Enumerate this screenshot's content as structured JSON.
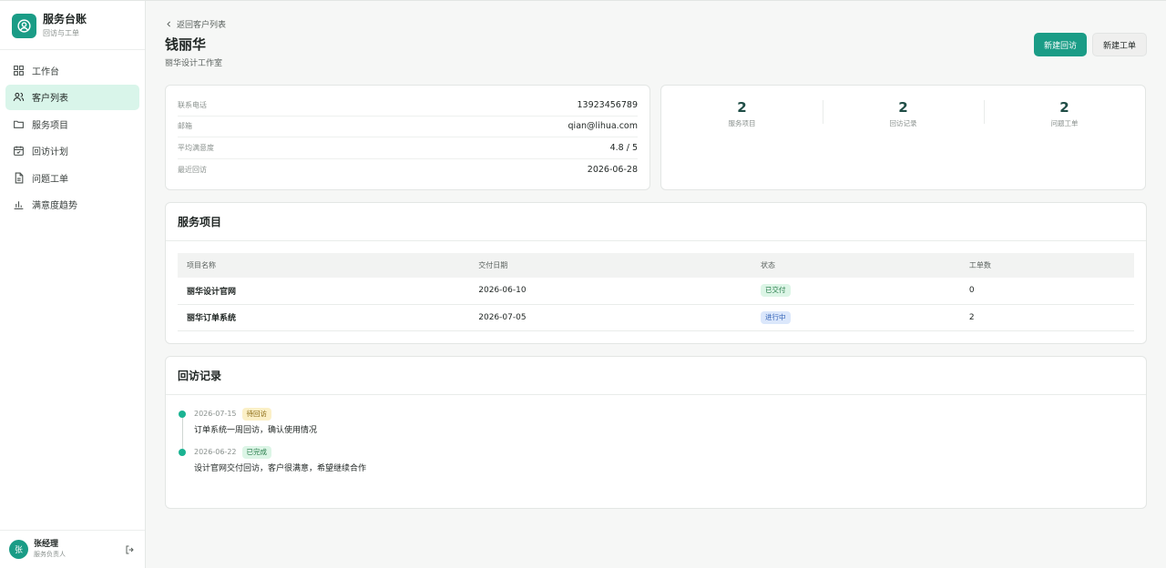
{
  "sidebar": {
    "brand_title": "服务台账",
    "brand_subtitle": "回访与工单",
    "items": [
      {
        "label": "工作台",
        "icon": "grid-icon",
        "active": false
      },
      {
        "label": "客户列表",
        "icon": "users-icon",
        "active": true
      },
      {
        "label": "服务项目",
        "icon": "folder-icon",
        "active": false
      },
      {
        "label": "回访计划",
        "icon": "calendar-check-icon",
        "active": false
      },
      {
        "label": "问题工单",
        "icon": "file-text-icon",
        "active": false
      },
      {
        "label": "满意度趋势",
        "icon": "bar-chart-icon",
        "active": false
      }
    ],
    "user": {
      "avatar_letter": "张",
      "name": "张经理",
      "role": "服务负责人"
    }
  },
  "header": {
    "back_label": "返回客户列表",
    "title": "钱丽华",
    "subtitle": "丽华设计工作室",
    "primary_button": "新建回访",
    "secondary_button": "新建工单"
  },
  "info": {
    "rows": [
      {
        "key": "联系电话",
        "value": "13923456789"
      },
      {
        "key": "邮箱",
        "value": "qian@lihua.com"
      },
      {
        "key": "平均满意度",
        "value": "4.8 / 5"
      },
      {
        "key": "最近回访",
        "value": "2026-06-28"
      }
    ]
  },
  "stats": [
    {
      "value": "2",
      "label": "服务项目"
    },
    {
      "value": "2",
      "label": "回访记录"
    },
    {
      "value": "2",
      "label": "问题工单"
    }
  ],
  "projects": {
    "title": "服务项目",
    "columns": [
      "项目名称",
      "交付日期",
      "状态",
      "工单数"
    ],
    "rows": [
      {
        "name": "丽华设计官网",
        "date": "2026-06-10",
        "status": "已交付",
        "tickets": "0"
      },
      {
        "name": "丽华订单系统",
        "date": "2026-07-05",
        "status": "进行中",
        "tickets": "2"
      }
    ]
  },
  "visits": {
    "title": "回访记录",
    "items": [
      {
        "date": "2026-07-15",
        "status": "待回访",
        "text": "订单系统一周回访，确认使用情况"
      },
      {
        "date": "2026-06-22",
        "status": "已完成",
        "text": "设计官网交付回访，客户很满意，希望继续合作"
      }
    ]
  },
  "colors": {
    "accent": "#1a9c86",
    "active_nav": "#d9f5ea"
  }
}
